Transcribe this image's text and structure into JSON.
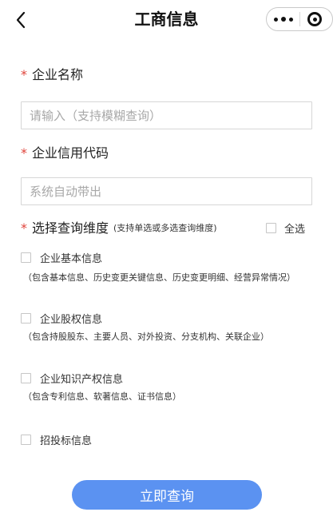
{
  "header": {
    "title": "工商信息",
    "back_icon": "chevron-left-icon",
    "more_icon": "more-dots-icon",
    "close_icon": "target-circle-icon"
  },
  "form": {
    "company_name": {
      "required_mark": "*",
      "label": "企业名称",
      "placeholder": "请输入（支持模糊查询）",
      "value": ""
    },
    "credit_code": {
      "required_mark": "*",
      "label": "企业信用代码",
      "placeholder": "系统自动带出",
      "value": ""
    },
    "query_dimensions": {
      "required_mark": "*",
      "label": "选择查询维度",
      "hint": "(支持单选或多选查询维度)",
      "select_all_label": "全选",
      "select_all_checked": false,
      "options": [
        {
          "label": "企业基本信息",
          "checked": false,
          "description": "（包含基本信息、历史变更关键信息、历史变更明细、经营异常情况）"
        },
        {
          "label": "企业股权信息",
          "checked": false,
          "description": "（包含持股股东、主要人员、对外投资、分支机构、关联企业）"
        },
        {
          "label": "企业知识产权信息",
          "checked": false,
          "description": "（包含专利信息、软著信息、证书信息）"
        },
        {
          "label": "招投标信息",
          "checked": false,
          "description": ""
        }
      ]
    },
    "submit_label": "立即查询"
  },
  "colors": {
    "required": "#e0443b",
    "primary_button": "#5b92f1",
    "border": "#d6d6d6",
    "placeholder": "#a8a8a8"
  }
}
